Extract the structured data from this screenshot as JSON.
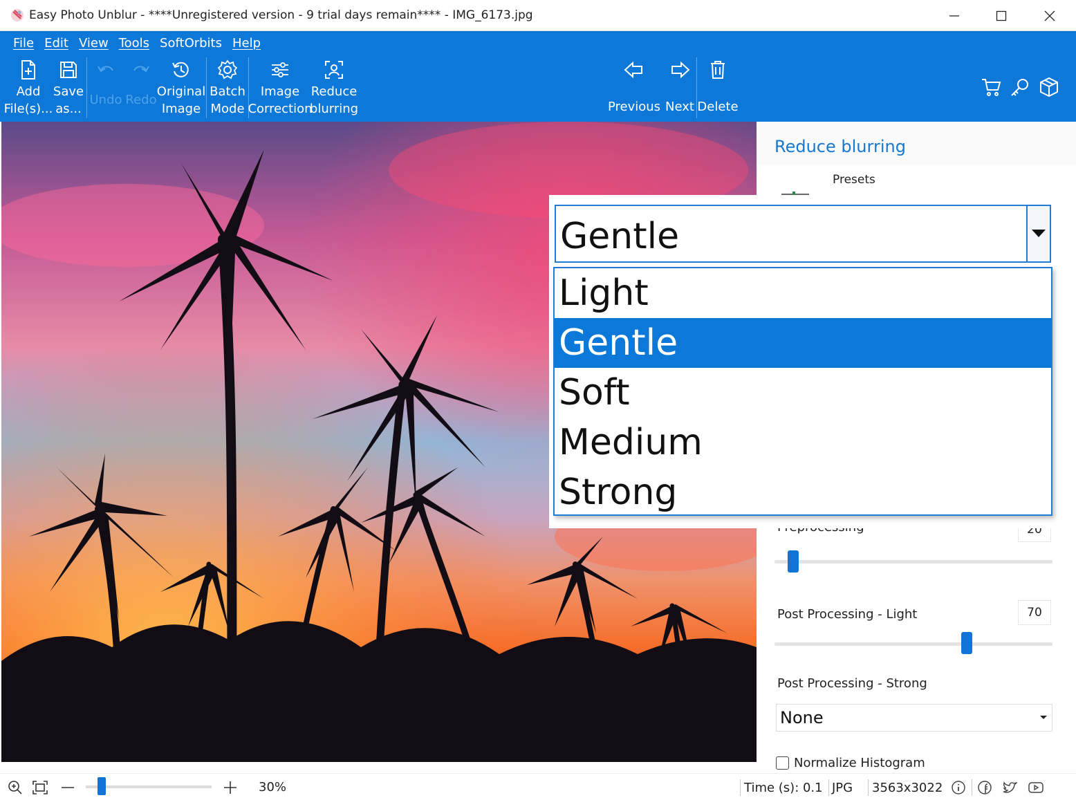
{
  "window": {
    "title": "Easy Photo Unblur - ****Unregistered version - 9 trial days remain**** - IMG_6173.jpg"
  },
  "menu": [
    "File",
    "Edit",
    "View",
    "Tools",
    "SoftOrbits",
    "Help"
  ],
  "toolbar": {
    "add": [
      "Add",
      "File(s)..."
    ],
    "save": [
      "Save",
      "as..."
    ],
    "undo": "Undo",
    "redo": "Redo",
    "original": [
      "Original",
      "Image"
    ],
    "batch": [
      "Batch",
      "Mode"
    ],
    "image_correction": [
      "Image",
      "Correction"
    ],
    "reduce_blurring": [
      "Reduce",
      "blurring"
    ],
    "previous": "Previous",
    "next": "Next",
    "delete": "Delete"
  },
  "panel": {
    "title": "Reduce blurring",
    "presets_label": "Presets",
    "preprocessing_label": "Preprocessing",
    "preprocessing_value": "20",
    "preprocessing_level": 0.05,
    "post_light_label": "Post Processing - Light",
    "post_light_value": "70",
    "post_light_level": 0.7,
    "post_strong_label": "Post Processing - Strong",
    "post_strong_value": "None",
    "normalize_label": "Normalize Histogram",
    "normalize_checked": false
  },
  "preset_dropdown": {
    "value": "Gentle",
    "options": [
      "Light",
      "Gentle",
      "Soft",
      "Medium",
      "Strong"
    ],
    "selected_index": 1
  },
  "status": {
    "zoom": "30%",
    "zoom_level": 0.1,
    "time": "Time (s): 0.1",
    "format": "JPG",
    "dimensions": "3563x3022"
  },
  "colors": {
    "ribbon": "#0d78d8",
    "accent": "#1274d6",
    "selection": "#0c78d8"
  }
}
